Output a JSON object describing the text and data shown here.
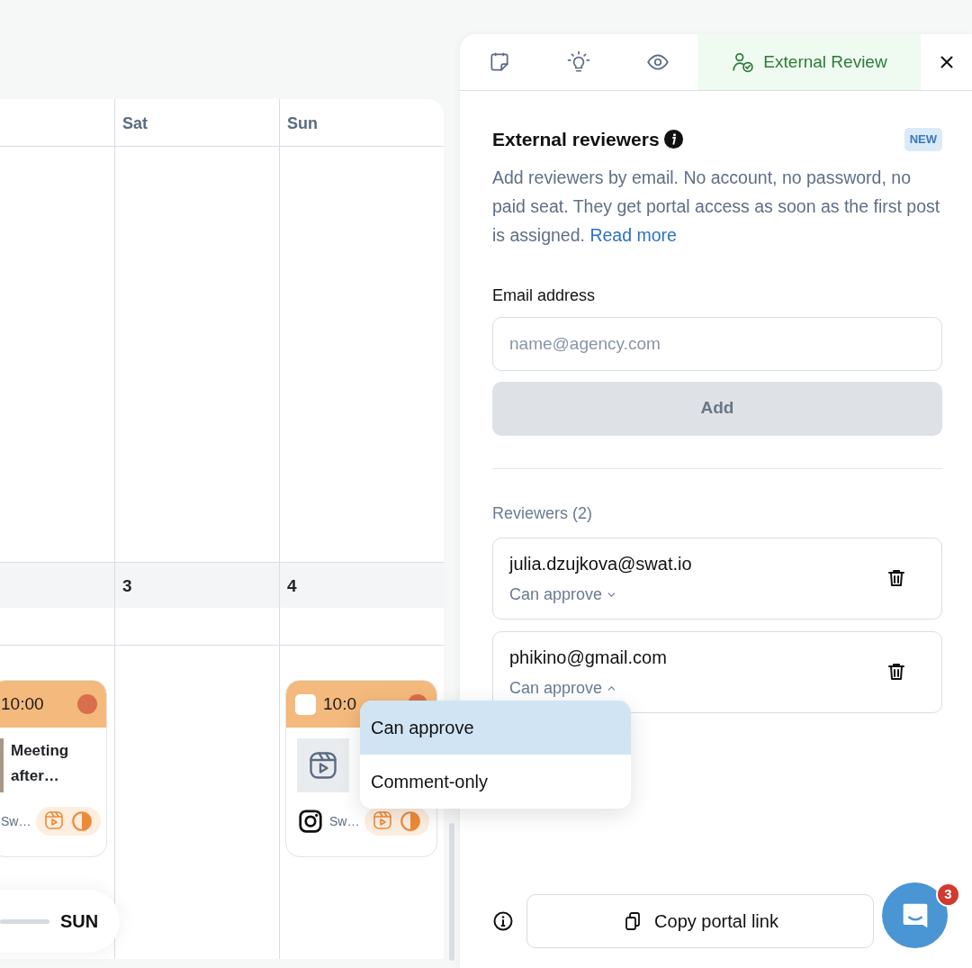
{
  "calendar": {
    "day_headers": [
      "Sat",
      "Sun"
    ],
    "date_numbers": [
      "3",
      "4"
    ],
    "events": [
      {
        "kind": "photo",
        "time": "10:00",
        "title": "Meeting after…",
        "account": "Sw…"
      },
      {
        "kind": "video",
        "time": "10:0",
        "account": "Sw…",
        "checked": false
      }
    ],
    "day_slider": {
      "label": "SUN",
      "level": 1
    }
  },
  "panel": {
    "tabs": [
      {
        "kind": "notes",
        "selected": false
      },
      {
        "kind": "ideas",
        "selected": false
      },
      {
        "kind": "preview",
        "selected": false
      },
      {
        "kind": "review",
        "label": "External Review",
        "selected": true
      }
    ],
    "title": "External reviewers",
    "badge": "NEW",
    "description": "Add reviewers by email. No account, no password, no paid seat. They get portal access as soon as the first post is assigned.",
    "link": "Read more",
    "email_field": {
      "label": "Email address",
      "placeholder": "name@agency.com"
    },
    "add_button": {
      "label": "Add",
      "disabled": true
    },
    "reviewers_heading": "Reviewers (2)",
    "reviewers": [
      {
        "email": "julia.dzujkova@swat.io",
        "permission": "Can approve",
        "expanded": false
      },
      {
        "email": "phikino@gmail.com",
        "permission": "Can approve",
        "expanded": true
      }
    ],
    "permission_menu": [
      {
        "label": "Can approve",
        "selected": true
      },
      {
        "label": "Comment-only",
        "selected": false
      }
    ],
    "copy_button": "Copy portal link",
    "chat_badge": "3"
  }
}
